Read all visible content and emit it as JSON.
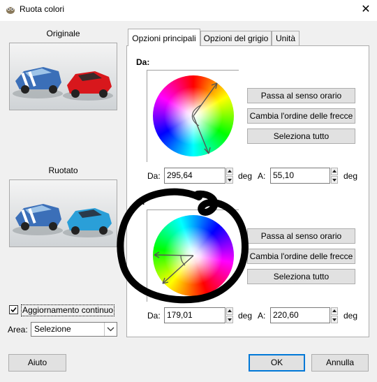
{
  "window": {
    "title": "Ruota colori",
    "close_label": "✕"
  },
  "previews": {
    "original_label": "Originale",
    "rotated_label": "Ruotato",
    "original_car_colors": [
      "#3b6fb8",
      "#d8171c"
    ],
    "rotated_car_colors": [
      "#3b6fb8",
      "#2a9fd8"
    ]
  },
  "tabs": [
    {
      "label": "Opzioni principali",
      "active": true
    },
    {
      "label": "Opzioni del grigio",
      "active": false
    },
    {
      "label": "Unità",
      "active": false
    }
  ],
  "from_section": {
    "label": "Da:",
    "buttons": {
      "clockwise": "Passa al senso orario",
      "swap": "Cambia l'ordine delle frecce",
      "select_all": "Seleziona tutto"
    },
    "from_field": {
      "label": "Da:",
      "value": "295,64",
      "unit": "deg"
    },
    "to_field": {
      "label": "A:",
      "value": "55,10",
      "unit": "deg"
    }
  },
  "to_section": {
    "label": "A:",
    "buttons": {
      "clockwise": "Passa al senso orario",
      "swap": "Cambia l'ordine delle frecce",
      "select_all": "Seleziona tutto"
    },
    "from_field": {
      "label": "Da:",
      "value": "179,01",
      "unit": "deg"
    },
    "to_field": {
      "label": "A:",
      "value": "220,60",
      "unit": "deg"
    }
  },
  "options": {
    "continuous_update_label": "Aggiornamento continuo",
    "continuous_update_checked": true,
    "area_label": "Area:",
    "area_value": "Selezione"
  },
  "footer": {
    "help_label": "Aiuto",
    "ok_label": "OK",
    "cancel_label": "Annulla"
  },
  "colors": {
    "dialog_bg": "#f0f0f0",
    "accent": "#0078d7",
    "annotation": "#000000"
  }
}
